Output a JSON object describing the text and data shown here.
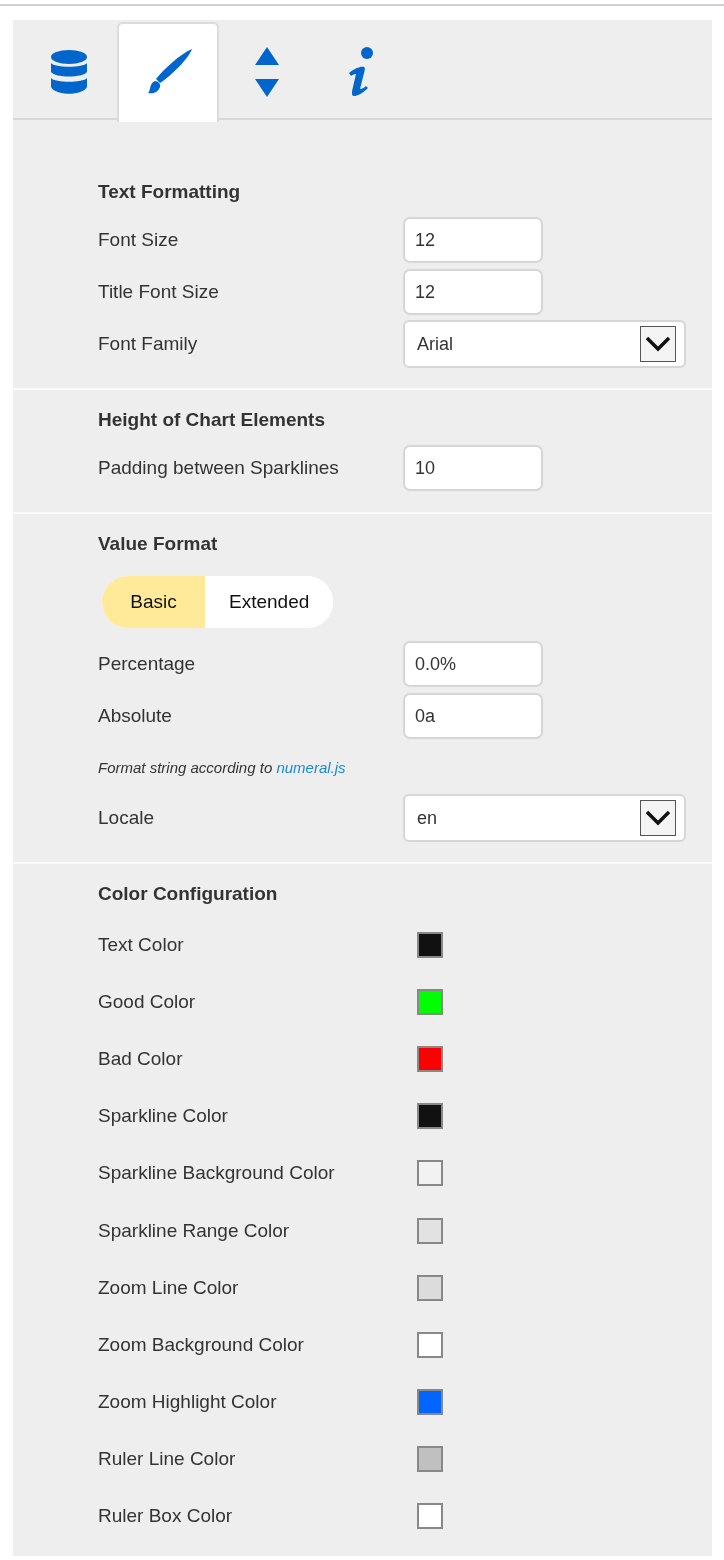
{
  "tabs": [
    {
      "kind": "database",
      "selected": false
    },
    {
      "kind": "brush",
      "selected": true
    },
    {
      "kind": "sort",
      "selected": false
    },
    {
      "kind": "info",
      "selected": false
    }
  ],
  "sections": [
    {
      "title": "Text Formatting",
      "rows": [
        {
          "kind": "number",
          "label": "Font Size",
          "value": "12"
        },
        {
          "kind": "number",
          "label": "Title Font Size",
          "value": "12"
        },
        {
          "kind": "select",
          "label": "Font Family",
          "value": "Arial"
        }
      ]
    },
    {
      "title": "Height of Chart Elements",
      "rows": [
        {
          "kind": "number",
          "label": "Padding between Sparklines",
          "value": "10"
        }
      ]
    },
    {
      "title": "Value Format",
      "rows": [
        {
          "kind": "toggle",
          "options": [
            {
              "label": "Basic",
              "selected": true
            },
            {
              "label": "Extended",
              "selected": false
            }
          ]
        },
        {
          "kind": "number",
          "label": "Percentage",
          "value": "0.0%"
        },
        {
          "kind": "number",
          "label": "Absolute",
          "value": "0a"
        },
        {
          "kind": "note",
          "text": "Format string according to ",
          "link": "numeral.js"
        },
        {
          "kind": "select",
          "label": "Locale",
          "value": "en"
        }
      ]
    },
    {
      "title": "Color Configuration",
      "rows": [
        {
          "kind": "color",
          "label": "Text Color",
          "color": "#111111"
        },
        {
          "kind": "color",
          "label": "Good Color",
          "color": "#00ff00"
        },
        {
          "kind": "color",
          "label": "Bad Color",
          "color": "#ff0000"
        },
        {
          "kind": "color",
          "label": "Sparkline Color",
          "color": "#111111"
        },
        {
          "kind": "color",
          "label": "Sparkline Background Color",
          "color": "#f2f2f2"
        },
        {
          "kind": "color",
          "label": "Sparkline Range Color",
          "color": "#e2e2e2"
        },
        {
          "kind": "color",
          "label": "Zoom Line Color",
          "color": "#dcdcdc"
        },
        {
          "kind": "color",
          "label": "Zoom Background Color",
          "color": "#ffffff"
        },
        {
          "kind": "color",
          "label": "Zoom Highlight Color",
          "color": "#0066ff"
        },
        {
          "kind": "color",
          "label": "Ruler Line Color",
          "color": "#c0c0c0"
        },
        {
          "kind": "color",
          "label": "Ruler Box Color",
          "color": "#ffffff"
        }
      ]
    }
  ]
}
